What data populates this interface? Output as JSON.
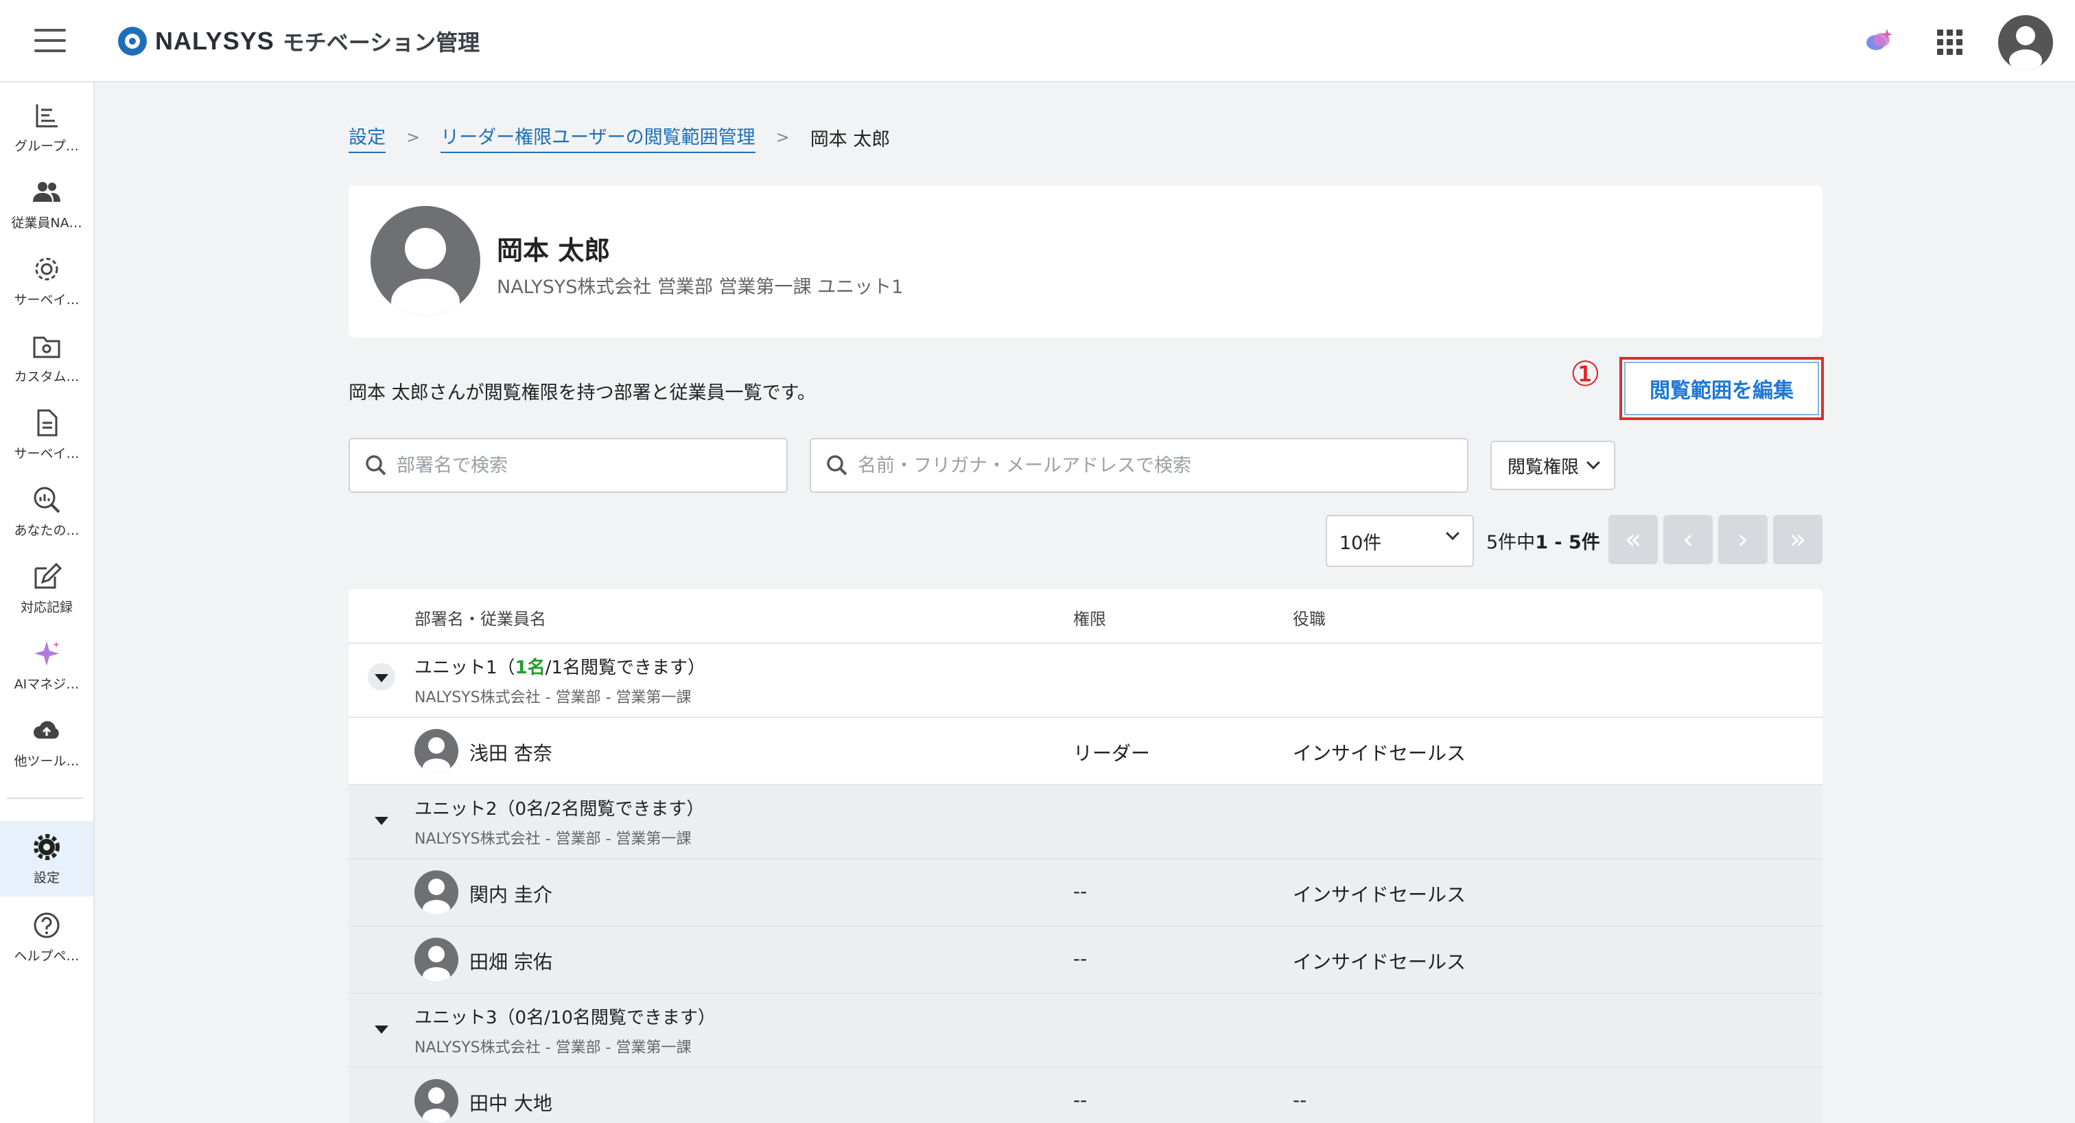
{
  "header": {
    "logo_text": "NALYSYS",
    "app_name": "モチベーション管理"
  },
  "sidebar": {
    "items": [
      {
        "label": "グループ…",
        "icon": "list-chart-icon"
      },
      {
        "label": "従業員NA…",
        "icon": "people-icon"
      },
      {
        "label": "サーベイ…",
        "icon": "gear-outline-icon"
      },
      {
        "label": "カスタム…",
        "icon": "folder-gear-icon"
      },
      {
        "label": "サーベイ…",
        "icon": "document-icon"
      },
      {
        "label": "あなたの…",
        "icon": "search-chart-icon"
      },
      {
        "label": "対応記録",
        "icon": "edit-icon"
      },
      {
        "label": "AIマネジ…",
        "icon": "sparkle-icon"
      },
      {
        "label": "他ツール…",
        "icon": "cloud-upload-icon"
      },
      {
        "label": "設定",
        "icon": "gear-icon"
      },
      {
        "label": "ヘルプペ…",
        "icon": "help-icon"
      }
    ]
  },
  "breadcrumb": {
    "items": [
      "設定",
      "リーダー権限ユーザーの閲覧範囲管理"
    ],
    "current": "岡本 太郎"
  },
  "profile": {
    "name": "岡本 太郎",
    "org": "NALYSYS株式会社 営業部 営業第一課 ユニット1"
  },
  "description": "岡本 太郎さんが閲覧権限を持つ部署と従業員一覧です。",
  "annotation": "①",
  "edit_button": "閲覧範囲を編集",
  "search": {
    "dept_placeholder": "部署名で検索",
    "name_placeholder": "名前・フリガナ・メールアドレスで検索"
  },
  "filter": {
    "label": "閲覧権限"
  },
  "pagination": {
    "per_page": "10件",
    "total": "5件中",
    "range": "1 - 5件"
  },
  "table": {
    "headers": [
      "部署名・従業員名",
      "権限",
      "役職"
    ],
    "groups": [
      {
        "name": "ユニット1（",
        "count_hl": "1名",
        "count_rest": "/1名閲覧できます）",
        "path": "NALYSYS株式会社 - 営業部 - 営業第一課",
        "employees": [
          {
            "name": "浅田 杏奈",
            "role": "リーダー",
            "title": "インサイドセールス"
          }
        ]
      },
      {
        "name": "ユニット2（0名/2名閲覧できます）",
        "path": "NALYSYS株式会社 - 営業部 - 営業第一課",
        "employees": [
          {
            "name": "関内 圭介",
            "role": "--",
            "title": "インサイドセールス"
          },
          {
            "name": "田畑 宗佑",
            "role": "--",
            "title": "インサイドセールス"
          }
        ]
      },
      {
        "name": "ユニット3（0名/10名閲覧できます）",
        "path": "NALYSYS株式会社 - 営業部 - 営業第一課",
        "employees": [
          {
            "name": "田中 大地",
            "role": "--",
            "title": "--"
          }
        ]
      }
    ]
  },
  "colors": {
    "accent": "#1e6fb9",
    "annotation": "#e02020",
    "highlight_green": "#1f9d2e"
  }
}
